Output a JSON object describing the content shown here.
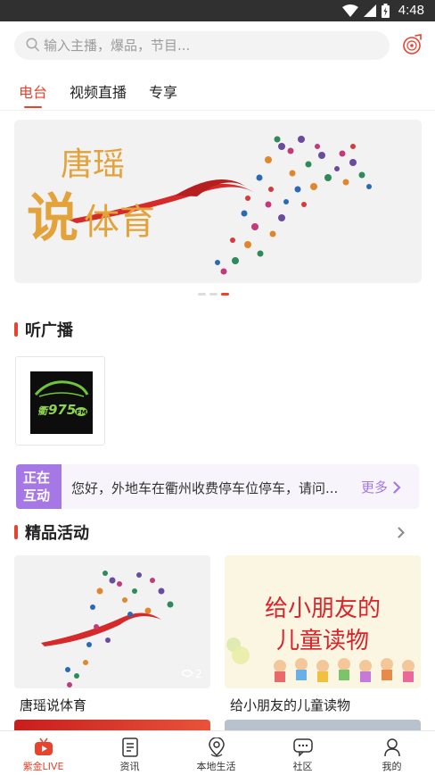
{
  "status_bar": {
    "time": "4:48"
  },
  "search": {
    "placeholder": "输入主播，爆品，节目..."
  },
  "tabs": [
    {
      "label": "电台",
      "active": true
    },
    {
      "label": "视频直播",
      "active": false
    },
    {
      "label": "专享",
      "active": false
    }
  ],
  "banner": {
    "line1": "唐瑶",
    "line2_big": "说",
    "line2_rest": "体育",
    "slide_count": 3,
    "active_slide": 3
  },
  "radio_section": {
    "title": "听广播"
  },
  "station": {
    "logo_text": "975",
    "logo_prefix": "衢",
    "logo_suffix": "FM"
  },
  "interaction": {
    "tag_line1": "正在",
    "tag_line2": "互动",
    "message": "您好，外地车在衢州收费停车位停车，请问...",
    "more_label": "更多"
  },
  "activities_section": {
    "title": "精品活动"
  },
  "activities": [
    {
      "title": "唐瑶说体育",
      "badge": "2"
    },
    {
      "title": "给小朋友的儿童读物",
      "poster_line1": "给小朋友的",
      "poster_line2": "儿童读物"
    }
  ],
  "bottom_nav": [
    {
      "label": "紫金LIVE",
      "icon": "live-tv-icon",
      "active": true
    },
    {
      "label": "资讯",
      "icon": "news-icon",
      "active": false
    },
    {
      "label": "本地生活",
      "icon": "location-pin-icon",
      "active": false
    },
    {
      "label": "社区",
      "icon": "community-chat-icon",
      "active": false
    },
    {
      "label": "我的",
      "icon": "user-icon",
      "active": false
    }
  ],
  "colors": {
    "accent": "#e8432e",
    "purple": "#a678e6",
    "status_bar": "#303030"
  }
}
